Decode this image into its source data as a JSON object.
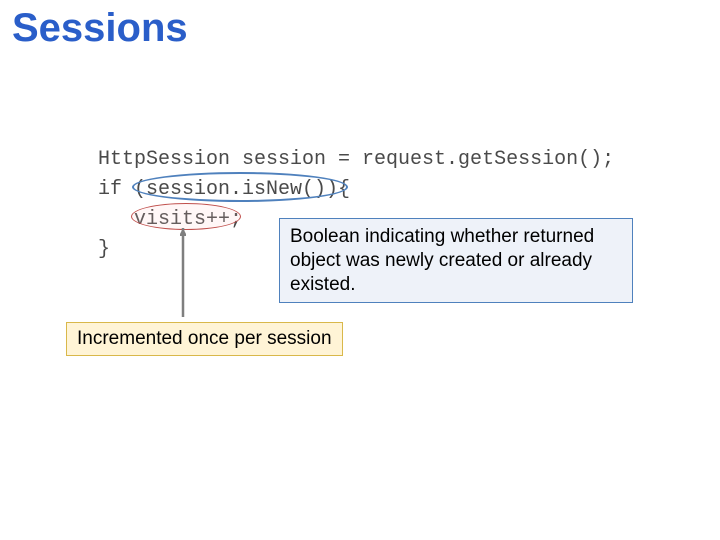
{
  "title": "Sessions",
  "code": {
    "line1": "HttpSession session = request.getSession();",
    "line2_pre": "if (",
    "line2_expr": "session.isNew()",
    "line2_post": "){",
    "line3": "visits++;",
    "line4": "}"
  },
  "callouts": {
    "blue": "Boolean indicating whether returned object was newly created or already existed.",
    "yellow": "Incremented once per session"
  }
}
